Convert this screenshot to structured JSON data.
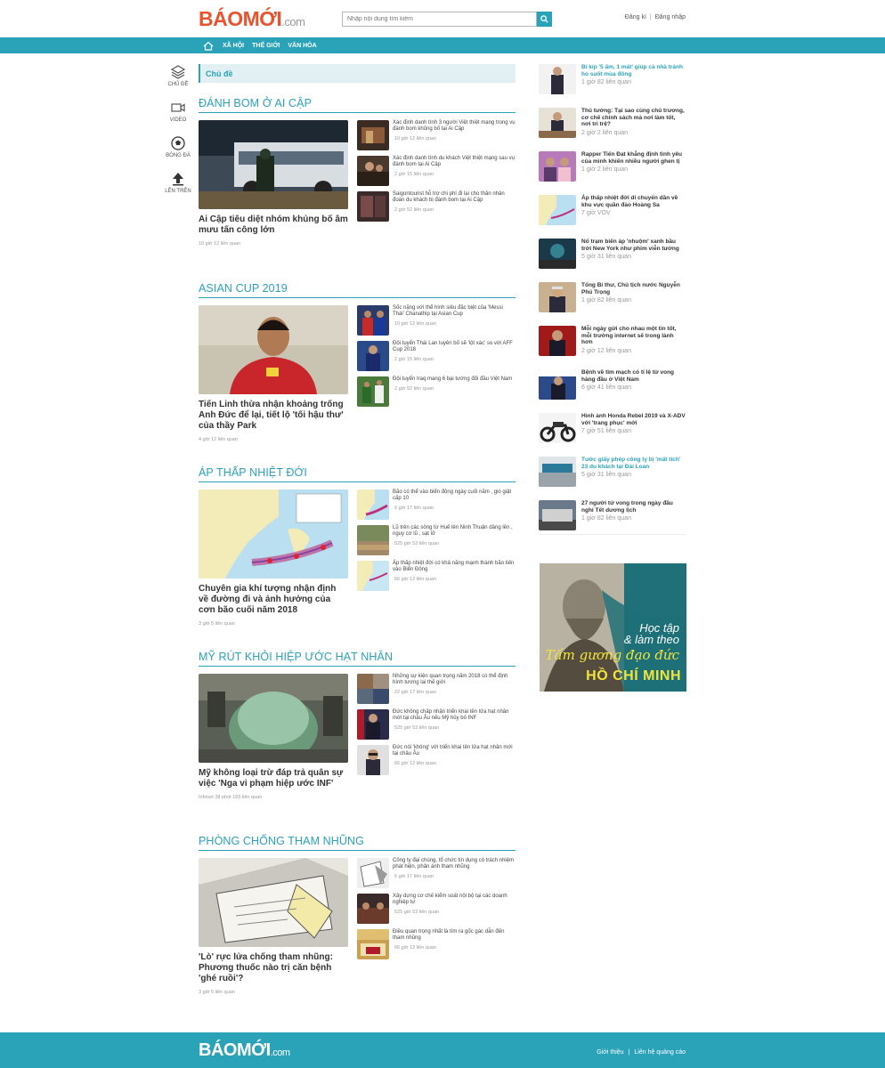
{
  "header": {
    "logo_bao": "BÁO",
    "logo_moi": "MỚI",
    "logo_com": ".com",
    "search_placeholder": "Nhập nội dung tìm kiếm",
    "register": "Đăng kí",
    "separator": "|",
    "login": "Đăng nhập"
  },
  "nav": {
    "items": [
      "XÃ HỘI",
      "THẾ GIỚI",
      "VĂN HÓA"
    ]
  },
  "rail": {
    "items": [
      "CHỦ ĐỀ",
      "VIDEO",
      "BÓNG ĐÁ",
      "LÊN TRÊN"
    ]
  },
  "topic_bar": "Chủ đề",
  "sections": [
    {
      "title": "ĐÁNH BOM Ở AI CẬP",
      "lead_title": "Ai Cập tiêu diệt nhóm khủng bố âm mưu tấn công lớn",
      "lead_meta": "10 giờ 12 liên quan",
      "items": [
        {
          "text": "Xác định danh tính 3 người Việt thiệt mạng trong vụ đánh bom khủng bố tại Ai Cập",
          "meta": "10 giờ 12 liên quan"
        },
        {
          "text": "Xác định danh tính du khách Việt thiệt mạng sau vụ đánh bom tại Ai Cập",
          "meta": "2 giờ 15 liên quan"
        },
        {
          "text": "Saigontourist hỗ trợ chi phí đi lại cho thân nhân đoàn du khách bị đánh bom tại Ai Cập",
          "meta": "2 giờ 52 liên quan"
        }
      ]
    },
    {
      "title": "ASIAN CUP 2019",
      "lead_title": "Tiến Linh thừa nhận khoảng trống Anh Đức để lại, tiết lộ 'tối hậu thư' của thầy Park",
      "lead_meta": "4 giờ 12 liên quan",
      "items": [
        {
          "text": "Sốc nặng với thể hình siêu đặc biệt của 'Messi Thái' Chanathip tại Asian Cup",
          "meta": "10 giờ 12 liên quan"
        },
        {
          "text": "Đội tuyển Thái Lan tuyên bố sẽ 'lột xác' so với AFF Cup 2018",
          "meta": "2 giờ 15 liên quan"
        },
        {
          "text": "Đội tuyển Iraq mang 6 bại tướng đối đầu Việt Nam",
          "meta": "2 giờ 52 liên quan"
        }
      ]
    },
    {
      "title": "ÁP THẤP NHIỆT ĐỚI",
      "lead_title": "Chuyên gia khí tượng nhận định về đường đi và ảnh hưởng của cơn bão cuối năm 2018",
      "lead_meta": "3 giờ 5 liên quan",
      "items": [
        {
          "text": "Bão có thể vào biển đông ngày cuối năm , gió giật cấp 10",
          "meta": "6 giờ 17 liên quan"
        },
        {
          "text": "Lũ trên các sông từ Huế lên Ninh Thuận dâng lên , nguy cơ lũ , sạt lở",
          "meta": "525 giờ 53 liên quan"
        },
        {
          "text": "Áp thấp nhiệt đới có khả năng mạnh thành bão tiến vào Biển Đông",
          "meta": "66 giờ 12 liên quan"
        }
      ]
    },
    {
      "title": "MỸ RÚT KHỎI HIỆP ƯỚC HẠT NHÂN",
      "lead_title": "Mỹ không loại trừ đáp trả quân sự việc 'Nga vi phạm hiệp ước INF'",
      "lead_meta": "Infonet 38 phút 165 liên quan",
      "items": [
        {
          "text": "Những sự kiện quan trọng năm 2018 có thể định hình tương lai thế giới",
          "meta": "22 giờ 17 liên quan"
        },
        {
          "text": "Đức không chấp nhận triển khai tên lửa hạt nhân mới tại châu Âu nếu Mỹ hủy bỏ INF",
          "meta": "525 giờ 53 liên quan"
        },
        {
          "text": "Đức nói 'không' với triển khai tên lửa hạt nhân mới tại châu Âu",
          "meta": "66 giờ 12 liên quan"
        }
      ]
    },
    {
      "title": "PHÒNG CHỐNG THAM NHŨNG",
      "lead_title": "'Lò' rực lửa chống tham nhũng: Phương thuốc nào trị căn bệnh 'ghé ruồi'?",
      "lead_meta": "3 giờ 5 liên quan",
      "items": [
        {
          "text": "Công ty đại chúng, tổ chức tín dụng có trách nhiệm phát hiện, phản ánh tham nhũng",
          "meta": "6 giờ 17 liên quan"
        },
        {
          "text": "Xây dựng cơ chế kiểm soát nội bộ tại các doanh nghiệp tư",
          "meta": "525 giờ 53 liên quan"
        },
        {
          "text": "Điều quan trọng nhất là tìm ra gốc gác dẫn đến tham nhũng",
          "meta": "66 giờ 12 liên quan"
        }
      ]
    }
  ],
  "right": [
    {
      "title": "Bí kíp '5 ấm, 1 mát' giúp cả nhà tránh ho suốt mùa đông",
      "meta": "1 giờ 82 liên quan",
      "highlight": true
    },
    {
      "title": "Thủ tướng: Tại sao cùng chủ trương, cơ chế chính sách mà nơi làm tốt, nơi trì trệ?",
      "meta": "2 giờ 2 liên quan",
      "highlight": false
    },
    {
      "title": "Rapper Tiến Đạt khẳng định tình yêu của mình khiến nhiều người ghen tị",
      "meta": "1 giờ 2 liên quan",
      "highlight": false
    },
    {
      "title": "Áp thấp nhiệt đới di chuyển dần về khu vực quần đảo Hoàng Sa",
      "meta": "7 giờ VOV",
      "highlight": false
    },
    {
      "title": "Nổ trạm biến áp 'nhuộm' xanh bầu trời New York như phim viễn tưởng",
      "meta": "5 giờ 31 liên quan",
      "highlight": false
    },
    {
      "title": "Tổng Bí thư, Chủ tịch nước Nguyễn Phú Trọng",
      "meta": "1 giờ 82 liên quan",
      "highlight": false
    },
    {
      "title": "Mỗi ngày gửi cho nhau một tin tốt, mỗi trường internet sẽ trong lành hơn",
      "meta": "2 giờ 12 liên quan",
      "highlight": false
    },
    {
      "title": "Bệnh về tim mạch có tỉ lệ tử vong hàng đầu ở Việt Nam",
      "meta": "6 giờ 41 liên quan",
      "highlight": false
    },
    {
      "title": "Hình ảnh Honda Rebel 2019 và X-ADV với 'trang phục' mới",
      "meta": "7 giờ 51 liên quan",
      "highlight": false
    },
    {
      "title": "Tước giấy phép công ty bị 'mất tích' 23 du khách tại Đài Loan",
      "meta": "5 giờ 31 liên quan",
      "highlight": true
    },
    {
      "title": "27 người tử vong trong ngày đầu nghỉ Tết dương lịch",
      "meta": "1 giờ 82 liên quan",
      "highlight": false
    }
  ],
  "ad": {
    "line1": "Học tập",
    "line1b": "& làm theo",
    "line2": "Tấm gương đạo đức",
    "line3": "HỒ CHÍ MINH"
  },
  "footer": {
    "logo_bao": "BÁO",
    "logo_moi": "MỚI",
    "logo_com": ".com",
    "about": "Giới thiệu",
    "separator": "|",
    "contact": "Liên hệ quảng cáo"
  },
  "colors": {
    "brand": "#2aa3b9",
    "logo_orange": "#e8542d",
    "ad_yellow": "#f3e43a"
  }
}
